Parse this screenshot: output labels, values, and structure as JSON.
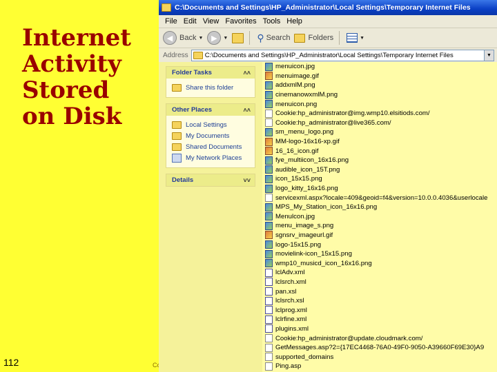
{
  "slide": {
    "title_lines": [
      "Internet",
      "Activity",
      "Stored",
      "on Disk"
    ],
    "page_number": "112",
    "footer_fragment": "Co"
  },
  "window": {
    "title": "C:\\Documents and Settings\\HP_Administrator\\Local Settings\\Temporary Internet Files",
    "menu": [
      "File",
      "Edit",
      "View",
      "Favorites",
      "Tools",
      "Help"
    ],
    "toolbar": {
      "back": "Back",
      "search": "Search",
      "folders": "Folders"
    },
    "address": {
      "label": "Address",
      "value": "C:\\Documents and Settings\\HP_Administrator\\Local Settings\\Temporary Internet Files"
    }
  },
  "taskpane": {
    "folder_tasks": {
      "title": "Folder Tasks",
      "items": [
        "Share this folder"
      ]
    },
    "other_places": {
      "title": "Other Places",
      "items": [
        "Local Settings",
        "My Documents",
        "Shared Documents",
        "My Network Places"
      ]
    },
    "details": {
      "title": "Details"
    }
  },
  "files": [
    {
      "name": "menuicon.jpg",
      "icon": "img"
    },
    {
      "name": "menuimage.gif",
      "icon": "gif"
    },
    {
      "name": "addxmlM.png",
      "icon": "img"
    },
    {
      "name": "cinemanowxmlM.png",
      "icon": "img"
    },
    {
      "name": "menuicon.png",
      "icon": "img"
    },
    {
      "name": "Cookie:hp_administrator@img.wmp10.elsitiods.com/",
      "icon": "txt"
    },
    {
      "name": "Cookie:hp_administrator@live365.com/",
      "icon": "txt"
    },
    {
      "name": "sm_menu_logo.png",
      "icon": "img"
    },
    {
      "name": "MM-logo-16x16-xp.gif",
      "icon": "gif"
    },
    {
      "name": "16_16_icon.gif",
      "icon": "gif"
    },
    {
      "name": "fye_multiicon_16x16.png",
      "icon": "img"
    },
    {
      "name": "audible_icon_15T.png",
      "icon": "img"
    },
    {
      "name": "icon_15x15.png",
      "icon": "img"
    },
    {
      "name": "logo_kitty_16x16.png",
      "icon": "img"
    },
    {
      "name": "servicexml.aspx?locale=409&geoid=f4&version=10.0.0.4036&userlocale",
      "icon": "txt"
    },
    {
      "name": "MPS_My_Station_icon_16x16.png",
      "icon": "img"
    },
    {
      "name": "Menulcon.jpg",
      "icon": "img"
    },
    {
      "name": "menu_image_s.png",
      "icon": "img"
    },
    {
      "name": "sgnsrv_imageurl.gif",
      "icon": "gif"
    },
    {
      "name": "logo-15x15.png",
      "icon": "img"
    },
    {
      "name": "movielink-icon_15x15.png",
      "icon": "img"
    },
    {
      "name": "wmp10_musicd_icon_16x16.png",
      "icon": "img"
    },
    {
      "name": "lclAdv.xml",
      "icon": "xml"
    },
    {
      "name": "lclsrch.xml",
      "icon": "xml"
    },
    {
      "name": "pan.xsl",
      "icon": "xml"
    },
    {
      "name": "lclsrch.xsl",
      "icon": "xml"
    },
    {
      "name": "lclprog.xml",
      "icon": "xml"
    },
    {
      "name": "lclrfine.xml",
      "icon": "xml"
    },
    {
      "name": "plugins.xml",
      "icon": "xml"
    },
    {
      "name": "Cookie:hp_administrator@update.cloudmark.com/",
      "icon": "txt"
    },
    {
      "name": "GetMessages.asp?2={17EC4468-76A0-49F0-9050-A39660F69E30}A9",
      "icon": "txt"
    },
    {
      "name": "supported_domains",
      "icon": "txt"
    },
    {
      "name": "Ping.asp",
      "icon": "txt"
    }
  ]
}
